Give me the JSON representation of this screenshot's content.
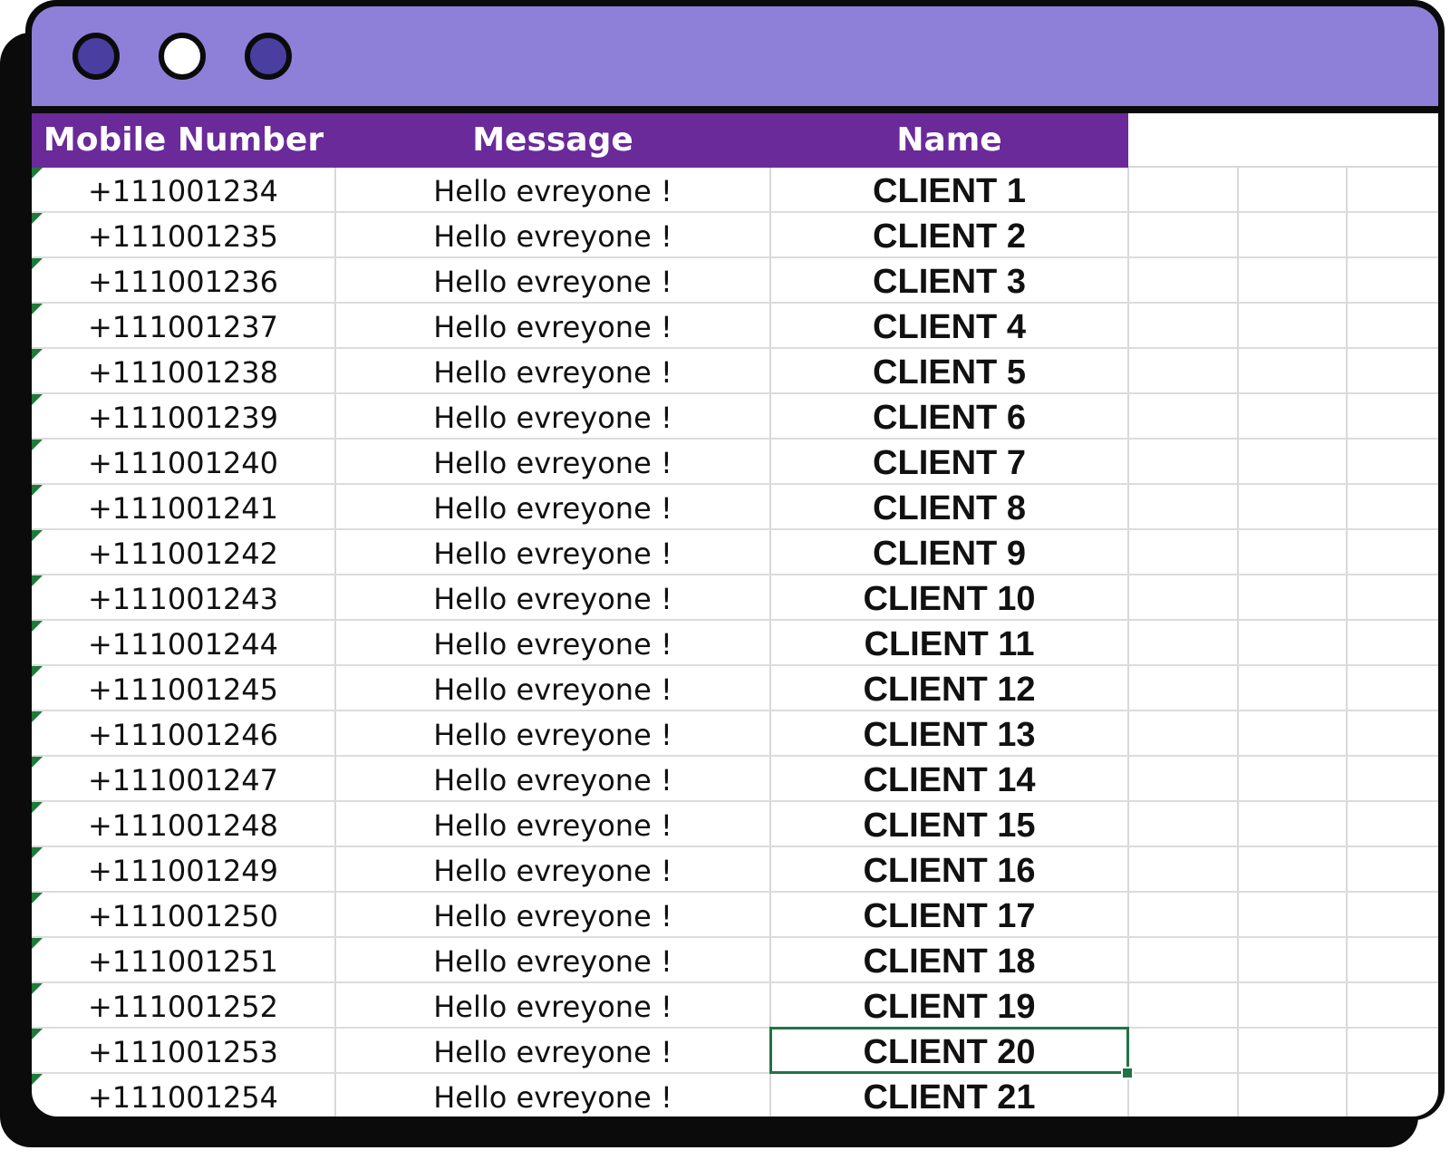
{
  "window": {
    "dots": [
      {
        "name": "window-dot-1",
        "color": "#4a3fa0"
      },
      {
        "name": "window-dot-2",
        "color": "#ffffff"
      },
      {
        "name": "window-dot-3",
        "color": "#4a3fa0"
      }
    ],
    "titlebar_color": "#8e80d8"
  },
  "table": {
    "header_color": "#6a2a9a",
    "columns": [
      "Mobile Number",
      "Message",
      "Name"
    ],
    "rows": [
      {
        "mobile": "+111001234",
        "message": "Hello evreyone !",
        "name": "CLIENT 1"
      },
      {
        "mobile": "+111001235",
        "message": "Hello evreyone !",
        "name": "CLIENT 2"
      },
      {
        "mobile": "+111001236",
        "message": "Hello evreyone !",
        "name": "CLIENT 3"
      },
      {
        "mobile": "+111001237",
        "message": "Hello evreyone !",
        "name": "CLIENT 4"
      },
      {
        "mobile": "+111001238",
        "message": "Hello evreyone !",
        "name": "CLIENT 5"
      },
      {
        "mobile": "+111001239",
        "message": "Hello evreyone !",
        "name": "CLIENT 6"
      },
      {
        "mobile": "+111001240",
        "message": "Hello evreyone !",
        "name": "CLIENT 7"
      },
      {
        "mobile": "+111001241",
        "message": "Hello evreyone !",
        "name": "CLIENT 8"
      },
      {
        "mobile": "+111001242",
        "message": "Hello evreyone !",
        "name": "CLIENT 9"
      },
      {
        "mobile": "+111001243",
        "message": "Hello evreyone !",
        "name": "CLIENT 10"
      },
      {
        "mobile": "+111001244",
        "message": "Hello evreyone !",
        "name": "CLIENT 11"
      },
      {
        "mobile": "+111001245",
        "message": "Hello evreyone !",
        "name": "CLIENT 12"
      },
      {
        "mobile": "+111001246",
        "message": "Hello evreyone !",
        "name": "CLIENT 13"
      },
      {
        "mobile": "+111001247",
        "message": "Hello evreyone !",
        "name": "CLIENT 14"
      },
      {
        "mobile": "+111001248",
        "message": "Hello evreyone !",
        "name": "CLIENT 15"
      },
      {
        "mobile": "+111001249",
        "message": "Hello evreyone !",
        "name": "CLIENT 16"
      },
      {
        "mobile": "+111001250",
        "message": "Hello evreyone !",
        "name": "CLIENT 17"
      },
      {
        "mobile": "+111001251",
        "message": "Hello evreyone !",
        "name": "CLIENT 18"
      },
      {
        "mobile": "+111001252",
        "message": "Hello evreyone !",
        "name": "CLIENT 19"
      },
      {
        "mobile": "+111001253",
        "message": "Hello evreyone !",
        "name": "CLIENT 20",
        "selected": true
      },
      {
        "mobile": "+111001254",
        "message": "Hello evreyone !",
        "name": "CLIENT 21"
      }
    ]
  }
}
